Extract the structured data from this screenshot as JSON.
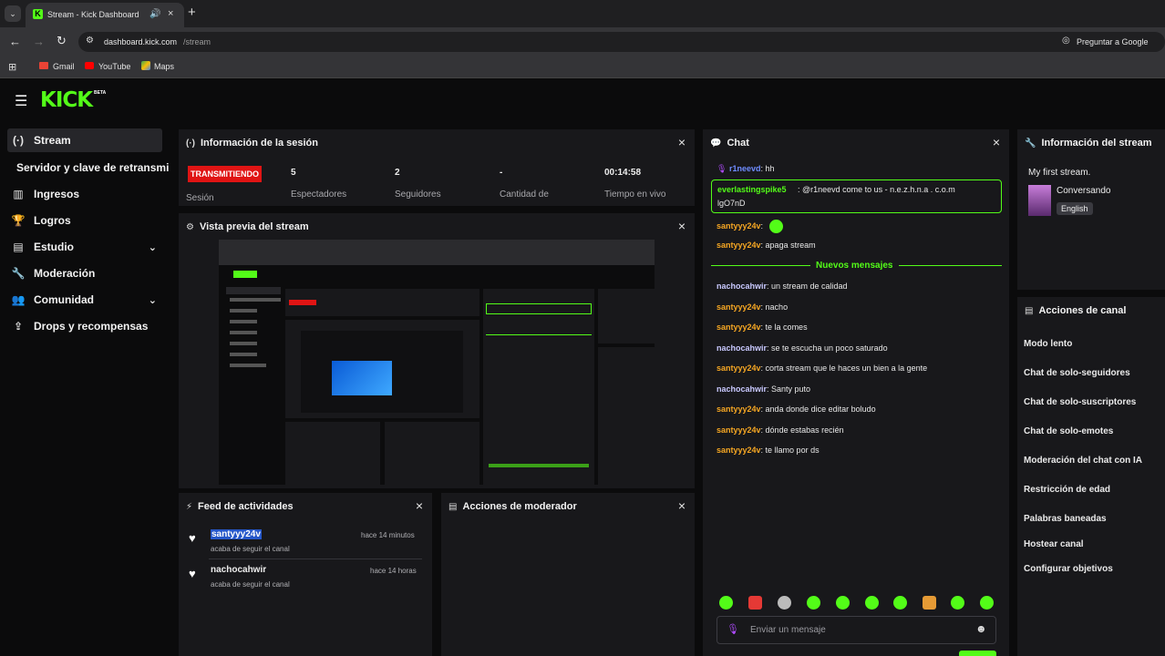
{
  "browser": {
    "tab_title": "Stream - Kick Dashboard",
    "url_host": "dashboard.kick.com",
    "url_path": "/stream",
    "ask_google": "Preguntar a Google",
    "bookmarks": [
      {
        "label": "Gmail",
        "icon": "gmail-icon"
      },
      {
        "label": "YouTube",
        "icon": "youtube-icon"
      },
      {
        "label": "Maps",
        "icon": "maps-icon"
      }
    ]
  },
  "app": {
    "logo": "KICK",
    "logo_badge": "BETA",
    "brand_color": "#53fc18"
  },
  "sidebar": {
    "items": [
      {
        "label": "Stream",
        "icon": "stream-icon",
        "active": true
      },
      {
        "label": "Servidor y clave de retransmi",
        "icon": "",
        "active": false
      },
      {
        "label": "Ingresos",
        "icon": "bar-chart-icon"
      },
      {
        "label": "Logros",
        "icon": "trophy-icon"
      },
      {
        "label": "Estudio",
        "icon": "studio-icon"
      },
      {
        "label": "Moderación",
        "icon": "wrench-icon"
      },
      {
        "label": "Comunidad",
        "icon": "users-icon"
      },
      {
        "label": "Drops y recompensas",
        "icon": "gift-icon"
      }
    ]
  },
  "session": {
    "title": "Información de la sesión",
    "status_badge": "TRANSMITIENDO",
    "status_label": "Sesión",
    "stats": [
      {
        "value": "5",
        "label": "Espectadores"
      },
      {
        "value": "2",
        "label": "Seguidores"
      },
      {
        "value": "-",
        "label": "Cantidad de"
      },
      {
        "value": "00:14:58",
        "label": "Tiempo en vivo"
      }
    ]
  },
  "preview": {
    "title": "Vista previa del stream"
  },
  "feed": {
    "title": "Feed de actividades",
    "items": [
      {
        "user": "santyyy24v",
        "desc": "acaba de seguir el canal",
        "time": "hace 14 minutos"
      },
      {
        "user": "nachocahwir",
        "desc": "acaba de seguir el canal",
        "time": "hace 14 horas"
      }
    ]
  },
  "modactions": {
    "title": "Acciones de moderador"
  },
  "chat": {
    "title": "Chat",
    "pinned_user": "r1neevd",
    "pinned_text": ": hh",
    "highlight_user": "everlastingspike5",
    "highlight_text_1": ": @r1neevd come to us - n.e.z.h.n.a . c.o.m",
    "highlight_text_2": "lgO7nD",
    "messages_before": [
      {
        "user": "santyyy24v",
        "text": ":"
      },
      {
        "user": "santyyy24v",
        "text": ": apaga stream"
      }
    ],
    "new_messages_label": "Nuevos mensajes",
    "messages": [
      {
        "user": "nachocahwir",
        "text": ": un stream de calidad",
        "color": "#c9c9ff"
      },
      {
        "user": "santyyy24v",
        "text": ": nacho",
        "color": "#f5a623"
      },
      {
        "user": "santyyy24v",
        "text": ": te la comes",
        "color": "#f5a623"
      },
      {
        "user": "nachocahwir",
        "text": ": se te escucha un poco saturado",
        "color": "#c9c9ff"
      },
      {
        "user": "santyyy24v",
        "text": ": corta stream que le haces un bien a la gente",
        "color": "#f5a623"
      },
      {
        "user": "nachocahwir",
        "text": ": Santy puto",
        "color": "#c9c9ff"
      },
      {
        "user": "santyyy24v",
        "text": ": anda donde dice editar boludo",
        "color": "#f5a623"
      },
      {
        "user": "santyyy24v",
        "text": ": dónde estabas recién",
        "color": "#f5a623"
      },
      {
        "user": "santyyy24v",
        "text": ": te llamo por ds",
        "color": "#f5a623"
      }
    ],
    "input_placeholder": "Enviar un mensaje"
  },
  "streaminfo": {
    "title": "Información del stream",
    "stream_title": "My first stream.",
    "category": "Conversando",
    "language": "English"
  },
  "channel_actions": {
    "title": "Acciones de canal",
    "items": [
      "Modo lento",
      "Chat de solo-seguidores",
      "Chat de solo-suscriptores",
      "Chat de solo-emotes",
      "Moderación del chat con IA",
      "Restricción de edad",
      "Palabras baneadas",
      "Hostear canal",
      "Configurar objetivos"
    ]
  }
}
